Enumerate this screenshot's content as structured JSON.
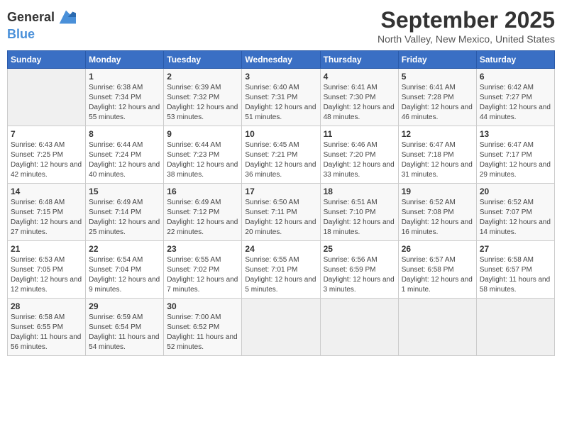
{
  "logo": {
    "general": "General",
    "blue": "Blue"
  },
  "title": "September 2025",
  "location": "North Valley, New Mexico, United States",
  "weekdays": [
    "Sunday",
    "Monday",
    "Tuesday",
    "Wednesday",
    "Thursday",
    "Friday",
    "Saturday"
  ],
  "weeks": [
    [
      {
        "day": "",
        "sunrise": "",
        "sunset": "",
        "daylight": ""
      },
      {
        "day": "1",
        "sunrise": "Sunrise: 6:38 AM",
        "sunset": "Sunset: 7:34 PM",
        "daylight": "Daylight: 12 hours and 55 minutes."
      },
      {
        "day": "2",
        "sunrise": "Sunrise: 6:39 AM",
        "sunset": "Sunset: 7:32 PM",
        "daylight": "Daylight: 12 hours and 53 minutes."
      },
      {
        "day": "3",
        "sunrise": "Sunrise: 6:40 AM",
        "sunset": "Sunset: 7:31 PM",
        "daylight": "Daylight: 12 hours and 51 minutes."
      },
      {
        "day": "4",
        "sunrise": "Sunrise: 6:41 AM",
        "sunset": "Sunset: 7:30 PM",
        "daylight": "Daylight: 12 hours and 48 minutes."
      },
      {
        "day": "5",
        "sunrise": "Sunrise: 6:41 AM",
        "sunset": "Sunset: 7:28 PM",
        "daylight": "Daylight: 12 hours and 46 minutes."
      },
      {
        "day": "6",
        "sunrise": "Sunrise: 6:42 AM",
        "sunset": "Sunset: 7:27 PM",
        "daylight": "Daylight: 12 hours and 44 minutes."
      }
    ],
    [
      {
        "day": "7",
        "sunrise": "Sunrise: 6:43 AM",
        "sunset": "Sunset: 7:25 PM",
        "daylight": "Daylight: 12 hours and 42 minutes."
      },
      {
        "day": "8",
        "sunrise": "Sunrise: 6:44 AM",
        "sunset": "Sunset: 7:24 PM",
        "daylight": "Daylight: 12 hours and 40 minutes."
      },
      {
        "day": "9",
        "sunrise": "Sunrise: 6:44 AM",
        "sunset": "Sunset: 7:23 PM",
        "daylight": "Daylight: 12 hours and 38 minutes."
      },
      {
        "day": "10",
        "sunrise": "Sunrise: 6:45 AM",
        "sunset": "Sunset: 7:21 PM",
        "daylight": "Daylight: 12 hours and 36 minutes."
      },
      {
        "day": "11",
        "sunrise": "Sunrise: 6:46 AM",
        "sunset": "Sunset: 7:20 PM",
        "daylight": "Daylight: 12 hours and 33 minutes."
      },
      {
        "day": "12",
        "sunrise": "Sunrise: 6:47 AM",
        "sunset": "Sunset: 7:18 PM",
        "daylight": "Daylight: 12 hours and 31 minutes."
      },
      {
        "day": "13",
        "sunrise": "Sunrise: 6:47 AM",
        "sunset": "Sunset: 7:17 PM",
        "daylight": "Daylight: 12 hours and 29 minutes."
      }
    ],
    [
      {
        "day": "14",
        "sunrise": "Sunrise: 6:48 AM",
        "sunset": "Sunset: 7:15 PM",
        "daylight": "Daylight: 12 hours and 27 minutes."
      },
      {
        "day": "15",
        "sunrise": "Sunrise: 6:49 AM",
        "sunset": "Sunset: 7:14 PM",
        "daylight": "Daylight: 12 hours and 25 minutes."
      },
      {
        "day": "16",
        "sunrise": "Sunrise: 6:49 AM",
        "sunset": "Sunset: 7:12 PM",
        "daylight": "Daylight: 12 hours and 22 minutes."
      },
      {
        "day": "17",
        "sunrise": "Sunrise: 6:50 AM",
        "sunset": "Sunset: 7:11 PM",
        "daylight": "Daylight: 12 hours and 20 minutes."
      },
      {
        "day": "18",
        "sunrise": "Sunrise: 6:51 AM",
        "sunset": "Sunset: 7:10 PM",
        "daylight": "Daylight: 12 hours and 18 minutes."
      },
      {
        "day": "19",
        "sunrise": "Sunrise: 6:52 AM",
        "sunset": "Sunset: 7:08 PM",
        "daylight": "Daylight: 12 hours and 16 minutes."
      },
      {
        "day": "20",
        "sunrise": "Sunrise: 6:52 AM",
        "sunset": "Sunset: 7:07 PM",
        "daylight": "Daylight: 12 hours and 14 minutes."
      }
    ],
    [
      {
        "day": "21",
        "sunrise": "Sunrise: 6:53 AM",
        "sunset": "Sunset: 7:05 PM",
        "daylight": "Daylight: 12 hours and 12 minutes."
      },
      {
        "day": "22",
        "sunrise": "Sunrise: 6:54 AM",
        "sunset": "Sunset: 7:04 PM",
        "daylight": "Daylight: 12 hours and 9 minutes."
      },
      {
        "day": "23",
        "sunrise": "Sunrise: 6:55 AM",
        "sunset": "Sunset: 7:02 PM",
        "daylight": "Daylight: 12 hours and 7 minutes."
      },
      {
        "day": "24",
        "sunrise": "Sunrise: 6:55 AM",
        "sunset": "Sunset: 7:01 PM",
        "daylight": "Daylight: 12 hours and 5 minutes."
      },
      {
        "day": "25",
        "sunrise": "Sunrise: 6:56 AM",
        "sunset": "Sunset: 6:59 PM",
        "daylight": "Daylight: 12 hours and 3 minutes."
      },
      {
        "day": "26",
        "sunrise": "Sunrise: 6:57 AM",
        "sunset": "Sunset: 6:58 PM",
        "daylight": "Daylight: 12 hours and 1 minute."
      },
      {
        "day": "27",
        "sunrise": "Sunrise: 6:58 AM",
        "sunset": "Sunset: 6:57 PM",
        "daylight": "Daylight: 11 hours and 58 minutes."
      }
    ],
    [
      {
        "day": "28",
        "sunrise": "Sunrise: 6:58 AM",
        "sunset": "Sunset: 6:55 PM",
        "daylight": "Daylight: 11 hours and 56 minutes."
      },
      {
        "day": "29",
        "sunrise": "Sunrise: 6:59 AM",
        "sunset": "Sunset: 6:54 PM",
        "daylight": "Daylight: 11 hours and 54 minutes."
      },
      {
        "day": "30",
        "sunrise": "Sunrise: 7:00 AM",
        "sunset": "Sunset: 6:52 PM",
        "daylight": "Daylight: 11 hours and 52 minutes."
      },
      {
        "day": "",
        "sunrise": "",
        "sunset": "",
        "daylight": ""
      },
      {
        "day": "",
        "sunrise": "",
        "sunset": "",
        "daylight": ""
      },
      {
        "day": "",
        "sunrise": "",
        "sunset": "",
        "daylight": ""
      },
      {
        "day": "",
        "sunrise": "",
        "sunset": "",
        "daylight": ""
      }
    ]
  ]
}
